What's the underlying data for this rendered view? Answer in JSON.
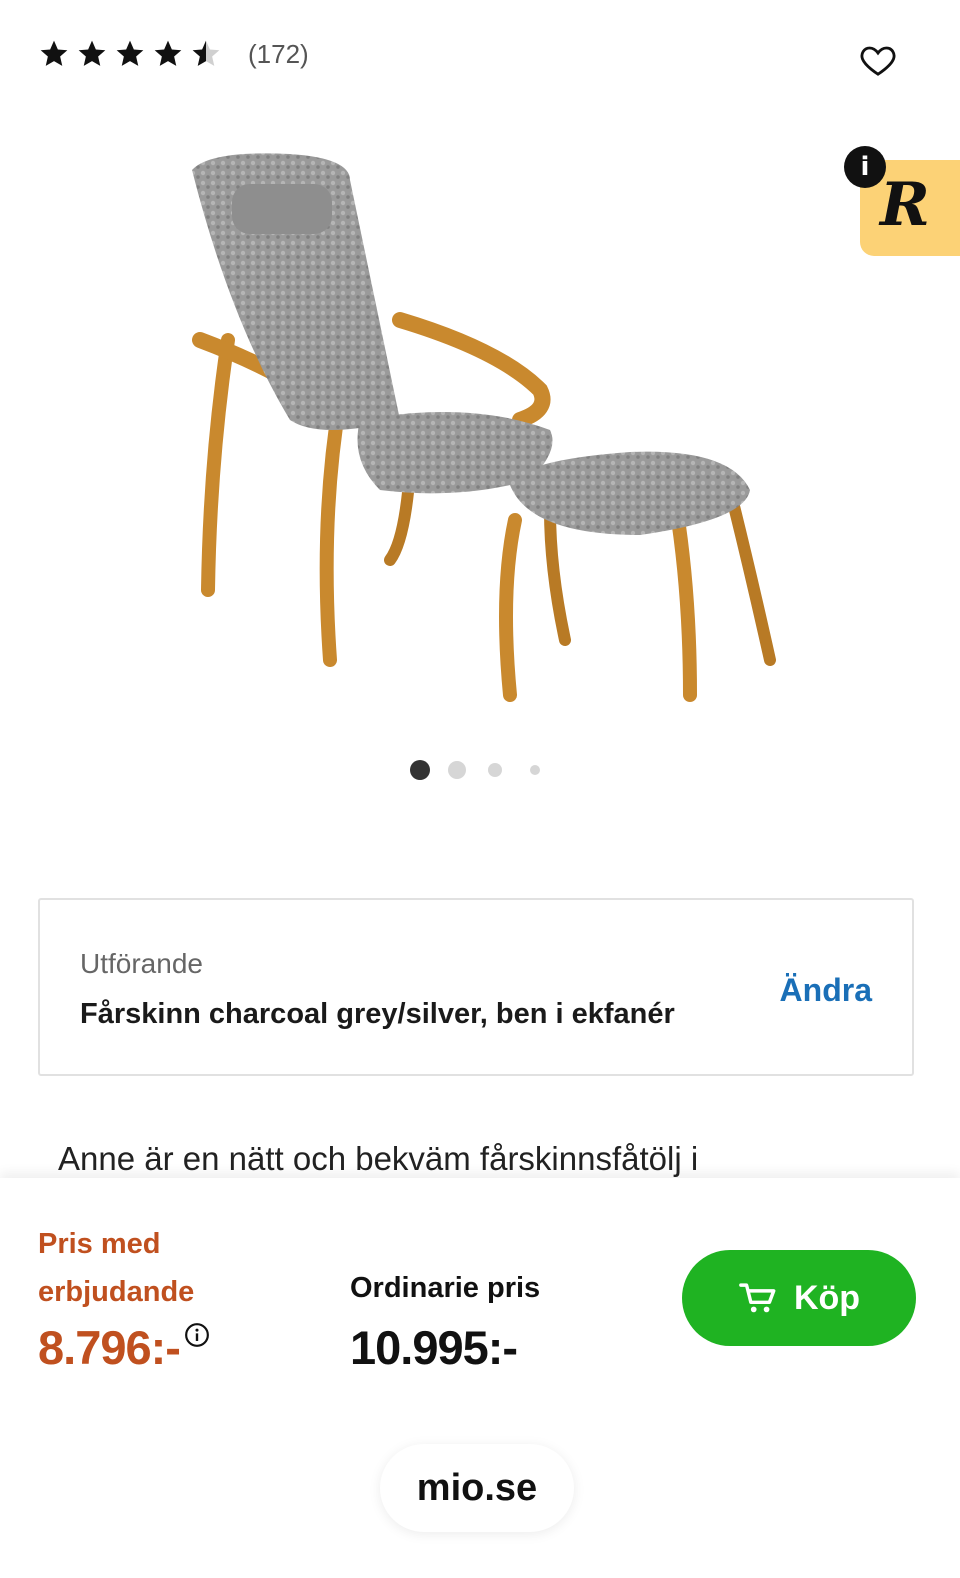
{
  "rating": {
    "value": 4.5,
    "max": 5,
    "review_count": "(172)"
  },
  "badge": {
    "letter": "R",
    "info": "i"
  },
  "gallery": {
    "image_count": 4,
    "active_index": 0
  },
  "variant": {
    "label": "Utförande",
    "value": "Fårskinn charcoal grey/silver, ben i ekfanér",
    "change_label": "Ändra"
  },
  "description": "Anne är en nätt och bekväm fårskinnsfåtölj i",
  "price": {
    "offer_label": "Pris med erbjudande",
    "offer_price": "8.796:-",
    "ordinary_label": "Ordinarie pris",
    "ordinary_price": "10.995:-"
  },
  "buy_label": "Köp",
  "url": "mio.se",
  "colors": {
    "offer": "#c0501f",
    "buy": "#1fb322",
    "link": "#1a6fb7",
    "badge": "#fcd276"
  },
  "icons": [
    "star-icon",
    "heart-icon",
    "info-icon",
    "cart-icon"
  ]
}
